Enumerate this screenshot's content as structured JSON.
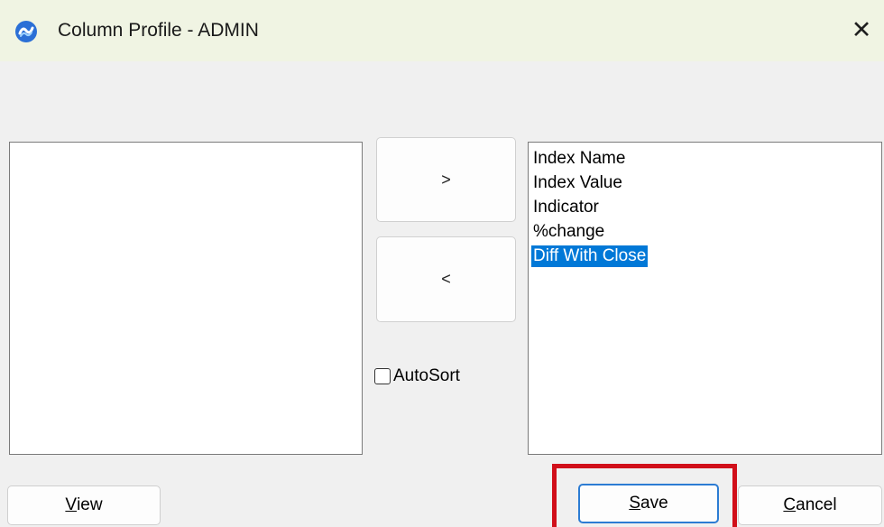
{
  "window": {
    "title": "Column Profile - ADMIN",
    "close_glyph": "✕",
    "icon": "app-logo-icon"
  },
  "left_list": {
    "items": []
  },
  "right_list": {
    "items": [
      {
        "label": "Index Name",
        "selected": false
      },
      {
        "label": "Index Value",
        "selected": false
      },
      {
        "label": "Indicator",
        "selected": false
      },
      {
        "label": "%change",
        "selected": false
      },
      {
        "label": "Diff With Close",
        "selected": true
      }
    ]
  },
  "move_buttons": {
    "right_label": ">",
    "left_label": "<"
  },
  "autosort": {
    "label": "AutoSort",
    "checked": false
  },
  "buttons": {
    "view_mnemonic": "V",
    "view_rest": "iew",
    "save_mnemonic": "S",
    "save_rest": "ave",
    "cancel_mnemonic": "C",
    "cancel_rest": "ancel"
  },
  "colors": {
    "titlebar": "#f0f4e3",
    "selection": "#0078d7",
    "highlight": "#d10f1a",
    "default_button_border": "#2c7cd3"
  }
}
